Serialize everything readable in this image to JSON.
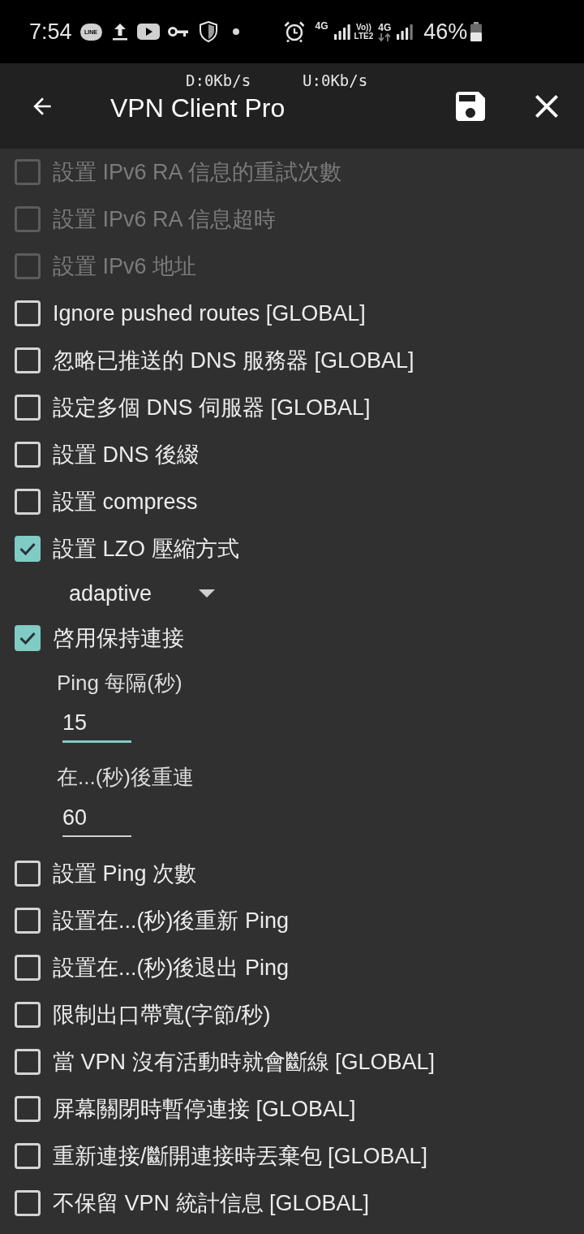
{
  "status_bar": {
    "time": "7:54",
    "app_badge": "LINE",
    "network_1": "4G",
    "volte": "Vo))",
    "lte": "LTE2",
    "network_2": "4G",
    "battery": "46%"
  },
  "toolbar": {
    "download_speed": "D:0Kb/s",
    "upload_speed": "U:0Kb/s",
    "title": "VPN Client Pro"
  },
  "options": [
    {
      "kind": "checkbox",
      "label": "設置 IPv6 RA 信息的重試次數",
      "checked": false,
      "disabled": true
    },
    {
      "kind": "checkbox",
      "label": "設置 IPv6 RA 信息超時",
      "checked": false,
      "disabled": true
    },
    {
      "kind": "checkbox",
      "label": "設置 IPv6 地址",
      "checked": false,
      "disabled": true
    },
    {
      "kind": "checkbox",
      "label": "Ignore pushed routes [GLOBAL]",
      "checked": false,
      "disabled": false
    },
    {
      "kind": "checkbox",
      "label": "忽略已推送的 DNS 服務器 [GLOBAL]",
      "checked": false,
      "disabled": false
    },
    {
      "kind": "checkbox",
      "label": "設定多個 DNS 伺服器 [GLOBAL]",
      "checked": false,
      "disabled": false
    },
    {
      "kind": "checkbox",
      "label": "設置 DNS 後綴",
      "checked": false,
      "disabled": false
    },
    {
      "kind": "checkbox",
      "label": "設置 compress",
      "checked": false,
      "disabled": false
    },
    {
      "kind": "checkbox",
      "label": "設置 LZO 壓縮方式",
      "checked": true,
      "disabled": false,
      "children": [
        {
          "kind": "dropdown",
          "value": "adaptive"
        }
      ]
    },
    {
      "kind": "checkbox",
      "label": "啓用保持連接",
      "checked": true,
      "disabled": false,
      "children": [
        {
          "kind": "label",
          "text": "Ping 每隔(秒)"
        },
        {
          "kind": "field",
          "value": "15",
          "focused": true
        },
        {
          "kind": "label",
          "text": "在...(秒)後重連"
        },
        {
          "kind": "field",
          "value": "60",
          "focused": false
        }
      ]
    },
    {
      "kind": "checkbox",
      "label": "設置 Ping 次數",
      "checked": false,
      "disabled": false
    },
    {
      "kind": "checkbox",
      "label": "設置在...(秒)後重新 Ping",
      "checked": false,
      "disabled": false
    },
    {
      "kind": "checkbox",
      "label": "設置在...(秒)後退出 Ping",
      "checked": false,
      "disabled": false
    },
    {
      "kind": "checkbox",
      "label": "限制出口帶寬(字節/秒)",
      "checked": false,
      "disabled": false
    },
    {
      "kind": "checkbox",
      "label": "當 VPN 沒有活動時就會斷線 [GLOBAL]",
      "checked": false,
      "disabled": false
    },
    {
      "kind": "checkbox",
      "label": "屏幕關閉時暫停連接 [GLOBAL]",
      "checked": false,
      "disabled": false
    },
    {
      "kind": "checkbox",
      "label": "重新連接/斷開連接時丟棄包 [GLOBAL]",
      "checked": false,
      "disabled": false
    },
    {
      "kind": "checkbox",
      "label": "不保留 VPN 統計信息 [GLOBAL]",
      "checked": false,
      "disabled": false
    }
  ]
}
